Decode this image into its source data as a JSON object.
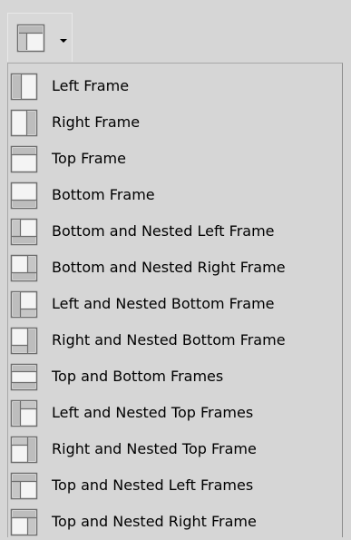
{
  "toolbar": {
    "button_icon": "frames-icon",
    "dropdown_icon": "dropdown-arrow-icon"
  },
  "menu": {
    "items": [
      {
        "label": "Left Frame",
        "icon": "left-frame-icon"
      },
      {
        "label": "Right Frame",
        "icon": "right-frame-icon"
      },
      {
        "label": "Top Frame",
        "icon": "top-frame-icon"
      },
      {
        "label": "Bottom Frame",
        "icon": "bottom-frame-icon"
      },
      {
        "label": "Bottom and Nested Left Frame",
        "icon": "bottom-nested-left-frame-icon"
      },
      {
        "label": "Bottom and Nested Right Frame",
        "icon": "bottom-nested-right-frame-icon"
      },
      {
        "label": "Left and Nested Bottom Frame",
        "icon": "left-nested-bottom-frame-icon"
      },
      {
        "label": "Right and Nested Bottom Frame",
        "icon": "right-nested-bottom-frame-icon"
      },
      {
        "label": "Top and Bottom Frames",
        "icon": "top-bottom-frames-icon"
      },
      {
        "label": "Left and Nested Top Frames",
        "icon": "left-nested-top-frames-icon"
      },
      {
        "label": "Right and Nested Top Frame",
        "icon": "right-nested-top-frame-icon"
      },
      {
        "label": "Top and Nested Left Frames",
        "icon": "top-nested-left-frames-icon"
      },
      {
        "label": "Top and Nested Right Frame",
        "icon": "top-nested-right-frame-icon"
      }
    ]
  }
}
